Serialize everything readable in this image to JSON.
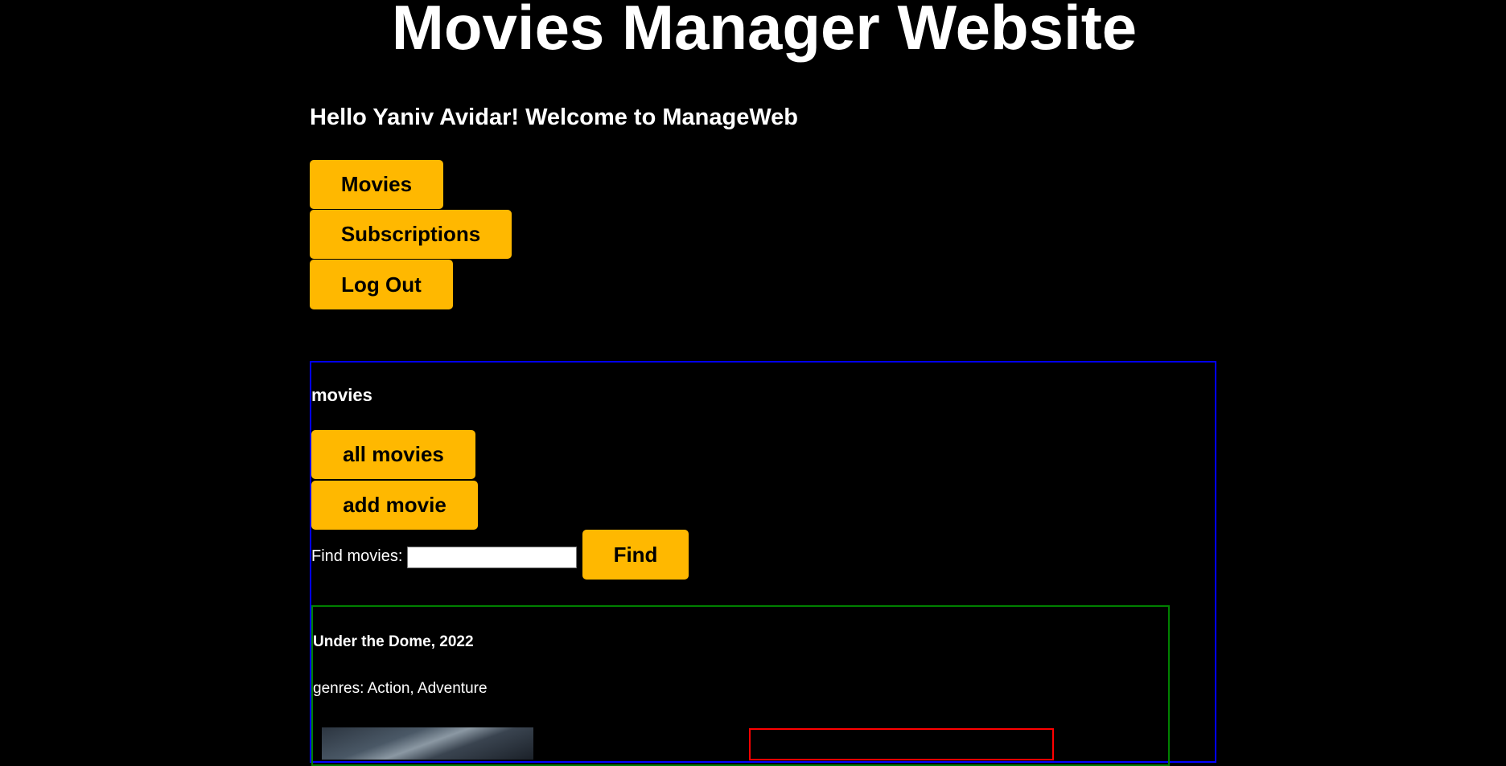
{
  "header": {
    "title": "Movies Manager Website",
    "greeting": "Hello Yaniv Avidar! Welcome to ManageWeb"
  },
  "nav": {
    "movies_label": "Movies",
    "subscriptions_label": "Subscriptions",
    "logout_label": "Log Out"
  },
  "movies_section": {
    "title": "movies",
    "all_movies_label": "all movies",
    "add_movie_label": "add movie",
    "find_label": "Find movies:",
    "find_value": "",
    "find_button_label": "Find"
  },
  "movies": [
    {
      "title": "Under the Dome, 2022",
      "genres": "genres: Action, Adventure"
    }
  ],
  "colors": {
    "background": "#000000",
    "button": "#ffb800",
    "panel_border": "#0000ff",
    "card_border": "#008000",
    "subscriptions_border": "#ff0000"
  }
}
